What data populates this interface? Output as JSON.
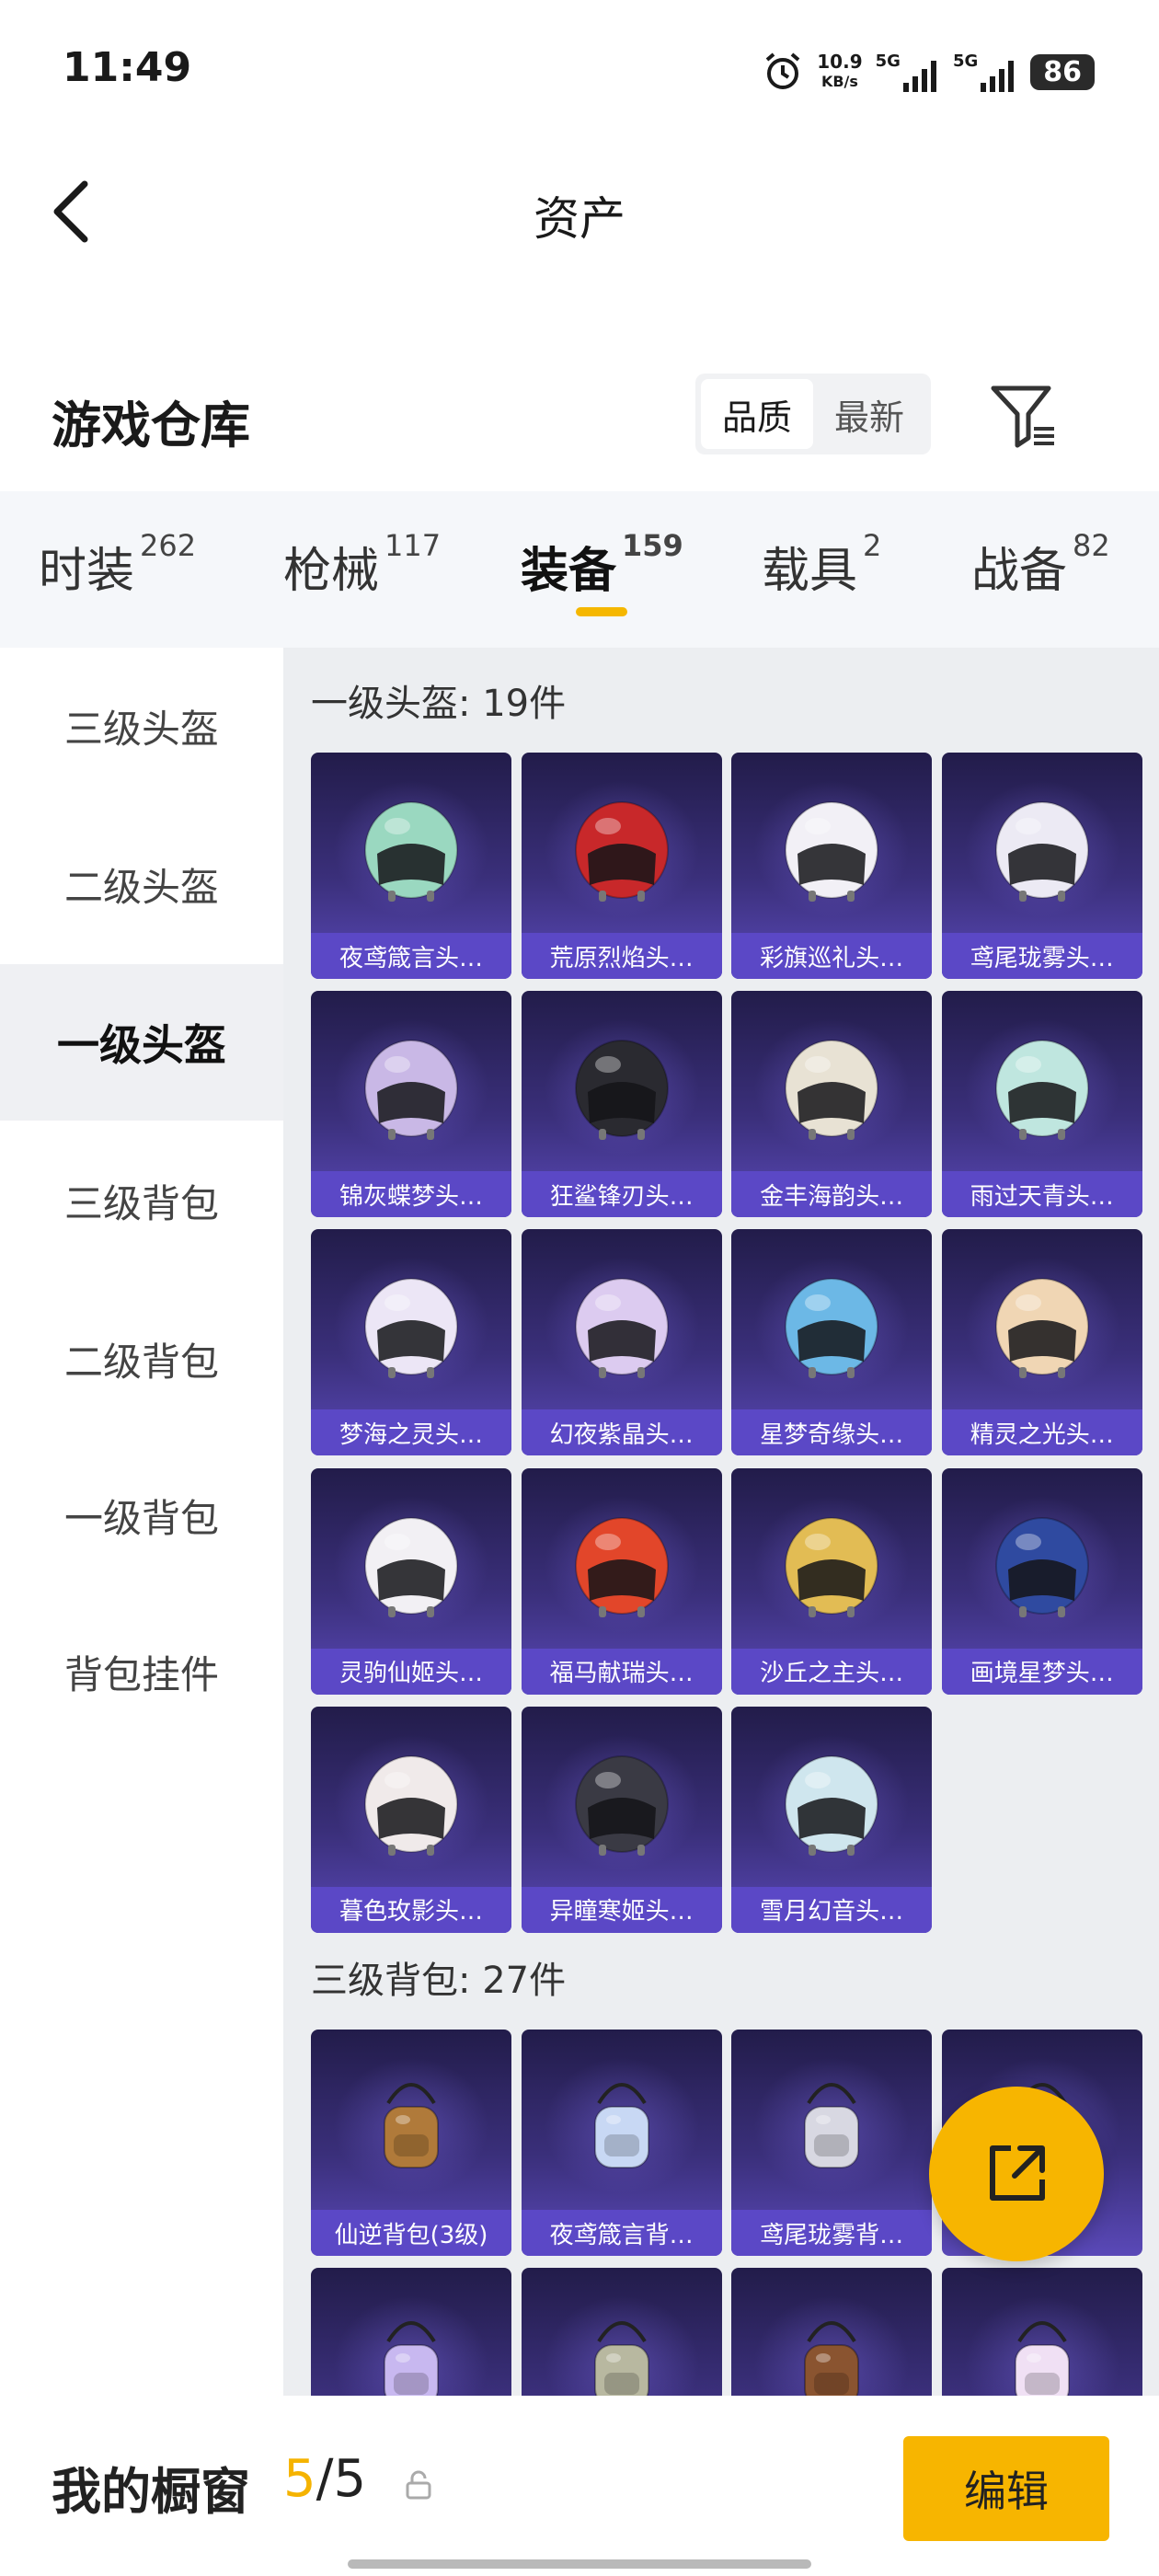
{
  "status_bar": {
    "time": "11:49",
    "speed_value": "10.9",
    "speed_unit": "KB/s",
    "net1": "5G",
    "net2": "5G",
    "battery": "86"
  },
  "header": {
    "title": "资产"
  },
  "section": {
    "title": "游戏仓库",
    "sort_options": [
      "品质",
      "最新"
    ],
    "sort_selected": "品质"
  },
  "tabs": [
    {
      "label": "时装",
      "count": "262"
    },
    {
      "label": "枪械",
      "count": "117"
    },
    {
      "label": "装备",
      "count": "159"
    },
    {
      "label": "载具",
      "count": "2"
    },
    {
      "label": "战备",
      "count": "82"
    }
  ],
  "sidebar": [
    "三级头盔",
    "二级头盔",
    "一级头盔",
    "三级背包",
    "二级背包",
    "一级背包",
    "背包挂件"
  ],
  "groups": [
    {
      "title": "一级头盔: 19件",
      "items": [
        {
          "name": "夜鸢箴言头…",
          "color": "#9ad8c0"
        },
        {
          "name": "荒原烈焰头…",
          "color": "#c8282a"
        },
        {
          "name": "彩旗巡礼头…",
          "color": "#f2f0f6"
        },
        {
          "name": "鸢尾珑雾头…",
          "color": "#eceaf4"
        },
        {
          "name": "锦灰蝶梦头…",
          "color": "#c9b8e6"
        },
        {
          "name": "狂鲨锋刃头…",
          "color": "#2a2a30"
        },
        {
          "name": "金丰海韵头…",
          "color": "#e8e2d4"
        },
        {
          "name": "雨过天青头…",
          "color": "#bfe6df"
        },
        {
          "name": "梦海之灵头…",
          "color": "#ece6f6"
        },
        {
          "name": "幻夜紫晶头…",
          "color": "#dccbf0"
        },
        {
          "name": "星梦奇缘头…",
          "color": "#6cb8e6"
        },
        {
          "name": "精灵之光头…",
          "color": "#f0d6b4"
        },
        {
          "name": "灵驹仙姬头…",
          "color": "#f2f0f4"
        },
        {
          "name": "福马献瑞头…",
          "color": "#e2462a"
        },
        {
          "name": "沙丘之主头…",
          "color": "#e2bc54"
        },
        {
          "name": "画境星梦头…",
          "color": "#2f4aa0"
        },
        {
          "name": "暮色玫影头…",
          "color": "#f0eaea"
        },
        {
          "name": "异瞳寒姬头…",
          "color": "#3a3a44"
        },
        {
          "name": "雪月幻音头…",
          "color": "#cfe6ee"
        }
      ]
    },
    {
      "title": "三级背包: 27件",
      "items": [
        {
          "name": "仙逆背包(3级)",
          "color": "#b07a3a"
        },
        {
          "name": "夜鸢箴言背…",
          "color": "#c8d8f4"
        },
        {
          "name": "鸢尾珑雾背…",
          "color": "#d8d8e2"
        },
        {
          "name": "",
          "color": "#e6e0ea"
        },
        {
          "name": "",
          "color": "#c8b8f0"
        },
        {
          "name": "",
          "color": "#b8b8a0"
        },
        {
          "name": "",
          "color": "#8a5430"
        },
        {
          "name": "",
          "color": "#f0e0f4"
        }
      ]
    }
  ],
  "bottom": {
    "title": "我的橱窗",
    "count_current": "5",
    "count_total": "/5",
    "edit_label": "编辑"
  }
}
